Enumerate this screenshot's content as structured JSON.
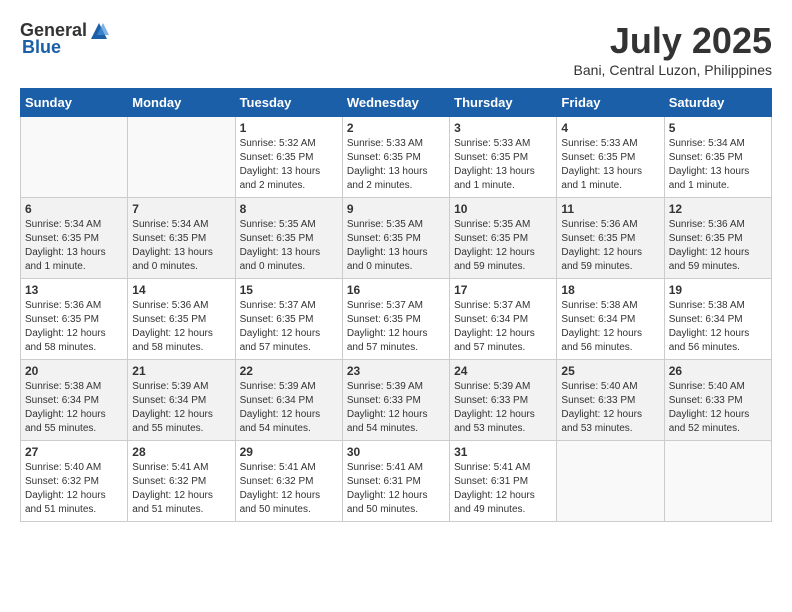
{
  "header": {
    "logo_general": "General",
    "logo_blue": "Blue",
    "month_title": "July 2025",
    "subtitle": "Bani, Central Luzon, Philippines"
  },
  "weekdays": [
    "Sunday",
    "Monday",
    "Tuesday",
    "Wednesday",
    "Thursday",
    "Friday",
    "Saturday"
  ],
  "weeks": [
    [
      {
        "day": "",
        "info": ""
      },
      {
        "day": "",
        "info": ""
      },
      {
        "day": "1",
        "info": "Sunrise: 5:32 AM\nSunset: 6:35 PM\nDaylight: 13 hours and 2 minutes."
      },
      {
        "day": "2",
        "info": "Sunrise: 5:33 AM\nSunset: 6:35 PM\nDaylight: 13 hours and 2 minutes."
      },
      {
        "day": "3",
        "info": "Sunrise: 5:33 AM\nSunset: 6:35 PM\nDaylight: 13 hours and 1 minute."
      },
      {
        "day": "4",
        "info": "Sunrise: 5:33 AM\nSunset: 6:35 PM\nDaylight: 13 hours and 1 minute."
      },
      {
        "day": "5",
        "info": "Sunrise: 5:34 AM\nSunset: 6:35 PM\nDaylight: 13 hours and 1 minute."
      }
    ],
    [
      {
        "day": "6",
        "info": "Sunrise: 5:34 AM\nSunset: 6:35 PM\nDaylight: 13 hours and 1 minute."
      },
      {
        "day": "7",
        "info": "Sunrise: 5:34 AM\nSunset: 6:35 PM\nDaylight: 13 hours and 0 minutes."
      },
      {
        "day": "8",
        "info": "Sunrise: 5:35 AM\nSunset: 6:35 PM\nDaylight: 13 hours and 0 minutes."
      },
      {
        "day": "9",
        "info": "Sunrise: 5:35 AM\nSunset: 6:35 PM\nDaylight: 13 hours and 0 minutes."
      },
      {
        "day": "10",
        "info": "Sunrise: 5:35 AM\nSunset: 6:35 PM\nDaylight: 12 hours and 59 minutes."
      },
      {
        "day": "11",
        "info": "Sunrise: 5:36 AM\nSunset: 6:35 PM\nDaylight: 12 hours and 59 minutes."
      },
      {
        "day": "12",
        "info": "Sunrise: 5:36 AM\nSunset: 6:35 PM\nDaylight: 12 hours and 59 minutes."
      }
    ],
    [
      {
        "day": "13",
        "info": "Sunrise: 5:36 AM\nSunset: 6:35 PM\nDaylight: 12 hours and 58 minutes."
      },
      {
        "day": "14",
        "info": "Sunrise: 5:36 AM\nSunset: 6:35 PM\nDaylight: 12 hours and 58 minutes."
      },
      {
        "day": "15",
        "info": "Sunrise: 5:37 AM\nSunset: 6:35 PM\nDaylight: 12 hours and 57 minutes."
      },
      {
        "day": "16",
        "info": "Sunrise: 5:37 AM\nSunset: 6:35 PM\nDaylight: 12 hours and 57 minutes."
      },
      {
        "day": "17",
        "info": "Sunrise: 5:37 AM\nSunset: 6:34 PM\nDaylight: 12 hours and 57 minutes."
      },
      {
        "day": "18",
        "info": "Sunrise: 5:38 AM\nSunset: 6:34 PM\nDaylight: 12 hours and 56 minutes."
      },
      {
        "day": "19",
        "info": "Sunrise: 5:38 AM\nSunset: 6:34 PM\nDaylight: 12 hours and 56 minutes."
      }
    ],
    [
      {
        "day": "20",
        "info": "Sunrise: 5:38 AM\nSunset: 6:34 PM\nDaylight: 12 hours and 55 minutes."
      },
      {
        "day": "21",
        "info": "Sunrise: 5:39 AM\nSunset: 6:34 PM\nDaylight: 12 hours and 55 minutes."
      },
      {
        "day": "22",
        "info": "Sunrise: 5:39 AM\nSunset: 6:34 PM\nDaylight: 12 hours and 54 minutes."
      },
      {
        "day": "23",
        "info": "Sunrise: 5:39 AM\nSunset: 6:33 PM\nDaylight: 12 hours and 54 minutes."
      },
      {
        "day": "24",
        "info": "Sunrise: 5:39 AM\nSunset: 6:33 PM\nDaylight: 12 hours and 53 minutes."
      },
      {
        "day": "25",
        "info": "Sunrise: 5:40 AM\nSunset: 6:33 PM\nDaylight: 12 hours and 53 minutes."
      },
      {
        "day": "26",
        "info": "Sunrise: 5:40 AM\nSunset: 6:33 PM\nDaylight: 12 hours and 52 minutes."
      }
    ],
    [
      {
        "day": "27",
        "info": "Sunrise: 5:40 AM\nSunset: 6:32 PM\nDaylight: 12 hours and 51 minutes."
      },
      {
        "day": "28",
        "info": "Sunrise: 5:41 AM\nSunset: 6:32 PM\nDaylight: 12 hours and 51 minutes."
      },
      {
        "day": "29",
        "info": "Sunrise: 5:41 AM\nSunset: 6:32 PM\nDaylight: 12 hours and 50 minutes."
      },
      {
        "day": "30",
        "info": "Sunrise: 5:41 AM\nSunset: 6:31 PM\nDaylight: 12 hours and 50 minutes."
      },
      {
        "day": "31",
        "info": "Sunrise: 5:41 AM\nSunset: 6:31 PM\nDaylight: 12 hours and 49 minutes."
      },
      {
        "day": "",
        "info": ""
      },
      {
        "day": "",
        "info": ""
      }
    ]
  ]
}
